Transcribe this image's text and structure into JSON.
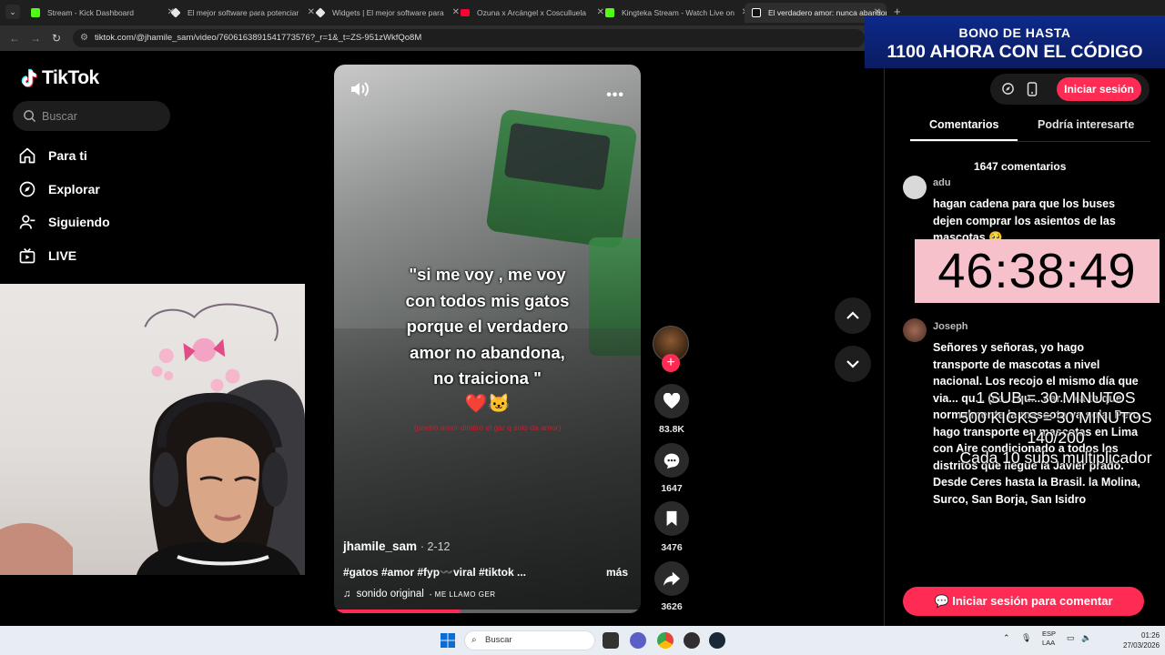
{
  "browser": {
    "tabs": [
      {
        "title": "Stream - Kick Dashboard",
        "color": "#53fc18"
      },
      {
        "title": "El mejor software para potenciar",
        "color": "#e6e6e6"
      },
      {
        "title": "Widgets | El mejor software para",
        "color": "#e6e6e6"
      },
      {
        "title": "Ozuna x Arcángel x Cosculluela",
        "color": "#ff0033"
      },
      {
        "title": "Kingteka Stream - Watch Live on",
        "color": "#53fc18"
      },
      {
        "title": "El verdadero amor: nunca abandona",
        "color": "#ffffff",
        "active": true
      }
    ],
    "new_tab": "+",
    "url": "tiktok.com/@jhamile_sam/video/7606163891541773576?_r=1&_t=ZS-951zWkfQo8M"
  },
  "tiktok": {
    "logo": "TikTok",
    "search_placeholder": "Buscar",
    "nav": [
      {
        "label": "Para ti",
        "icon": "home-icon"
      },
      {
        "label": "Explorar",
        "icon": "compass-icon"
      },
      {
        "label": "Siguiendo",
        "icon": "following-icon"
      },
      {
        "label": "LIVE",
        "icon": "live-icon"
      }
    ]
  },
  "video": {
    "caption_overlay": "\"si me voy , me voy\ncon todos mis gatos\nporque el verdadero\namor no abandona,\nno traiciona \"",
    "emoji_overlay": "❤️🐱",
    "red_text": "(pnetro amor dimitro el gar q solo da amor)",
    "author": "jhamile_sam",
    "date": "2-12",
    "tags": "#gatos #amor #fyp〰️viral #tiktok ...",
    "more": "más",
    "sound_label": "sonido original",
    "sound_artist": "- ME LLAMO GER",
    "progress": 0.41
  },
  "actions": {
    "likes": "83.8K",
    "comments": "1647",
    "saves": "3476",
    "shares": "3626"
  },
  "right_panel": {
    "bono_line1": "BONO DE HASTA",
    "bono_line2": "1100 AHORA CON EL CÓDIGO",
    "login_button": "Iniciar sesión",
    "tab_comments": "Comentarios",
    "tab_interest": "Podría interesarte",
    "comment_count": "1647 comentarios",
    "comments": [
      {
        "user": "adu",
        "text": "hagan cadena para que los buses dejen comprar los asientos de las mascotas 🥺"
      },
      {
        "user": "Joseph",
        "text": "Señores y señoras, yo hago transporte de mascotas a nivel nacional. Los recojo el mismo día que via... qu... (ca... qu... car... xa ta que normalmente la mascota va sola. Pero hago transporte en mascotas en Lima con Aire condicionado a todos los distritos que llegue la Javier prado. Desde Ceres hasta la Brasil. la Molina, Surco, San Borja, San Isidro"
      }
    ],
    "comment_login": "Iniciar sesión para comentar"
  },
  "stream_overlay": {
    "timer": "46:38:49",
    "sub_rule": "1 SUB      = 30 MINUTOS",
    "kicks_rule": "500 KICKS = 30 MINUTOS",
    "progress": "140/200",
    "multiplier": "Cada 10 subs multiplicador"
  },
  "taskbar": {
    "search": "Buscar",
    "lang": "ESP",
    "lang2": "LAA",
    "time": "01:26",
    "date": "27/03/2026"
  }
}
